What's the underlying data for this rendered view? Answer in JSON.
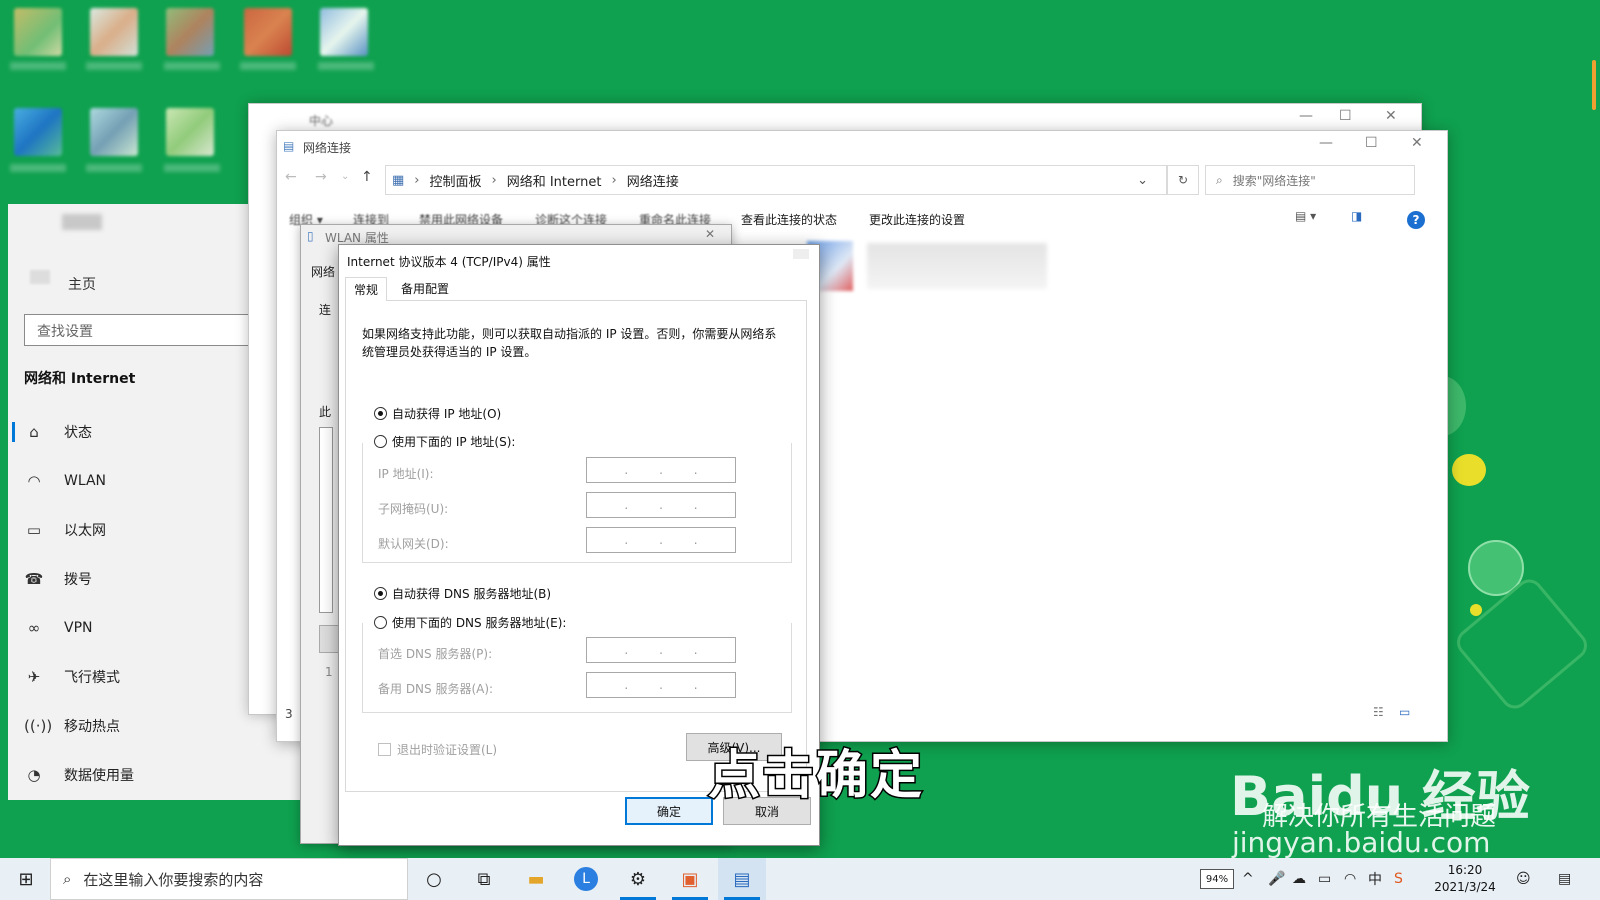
{
  "settings": {
    "home": "主页",
    "search_placeholder": "查找设置",
    "section": "网络和 Internet",
    "nav": [
      {
        "label": "状态",
        "icon": "home-icon"
      },
      {
        "label": "WLAN",
        "icon": "wifi-icon"
      },
      {
        "label": "以太网",
        "icon": "ethernet-icon"
      },
      {
        "label": "拨号",
        "icon": "dialup-icon"
      },
      {
        "label": "VPN",
        "icon": "vpn-icon"
      },
      {
        "label": "飞行模式",
        "icon": "airplane-icon"
      },
      {
        "label": "移动热点",
        "icon": "hotspot-icon"
      },
      {
        "label": "数据使用量",
        "icon": "data-usage-icon"
      }
    ]
  },
  "netcenter": {
    "title": "中心"
  },
  "netconn": {
    "title": "网络连接",
    "breadcrumb": [
      "控制面板",
      "网络和 Internet",
      "网络连接"
    ],
    "search_placeholder": "搜索\"网络连接\"",
    "toolbar": [
      "组织 ▾",
      "连接到",
      "禁用此网络设备",
      "诊断这个连接",
      "重命名此连接",
      "查看此连接的状态",
      "更改此连接的设置"
    ],
    "status_count": "3"
  },
  "wlan": {
    "title": "WLAN 属性",
    "tab": "网络",
    "label_conn": "连",
    "label_this": "此",
    "label_install": "1"
  },
  "tcp": {
    "title": "Internet 协议版本 4 (TCP/IPv4) 属性",
    "tabs": [
      "常规",
      "备用配置"
    ],
    "description": "如果网络支持此功能，则可以获取自动指派的 IP 设置。否则，你需要从网络系统管理员处获得适当的 IP 设置。",
    "auto_ip": "自动获得 IP 地址(O)",
    "manual_ip": "使用下面的 IP 地址(S):",
    "ip_label": "IP 地址(I):",
    "mask_label": "子网掩码(U):",
    "gateway_label": "默认网关(D):",
    "auto_dns": "自动获得 DNS 服务器地址(B)",
    "manual_dns": "使用下面的 DNS 服务器地址(E):",
    "pref_dns_label": "首选 DNS 服务器(P):",
    "alt_dns_label": "备用 DNS 服务器(A):",
    "validate": "退出时验证设置(L)",
    "advanced": "高级(V)...",
    "ok": "确定",
    "cancel": "取消",
    "dot": "."
  },
  "caption": "点击确定",
  "watermark": {
    "brand": "Baidu 经验",
    "slogan": "解决你所有生活问题",
    "url": "jingyan.baidu.com"
  },
  "taskbar": {
    "search_placeholder": "在这里输入你要搜索的内容",
    "battery": "94%",
    "time": "16:20",
    "date": "2021/3/24"
  },
  "colors": {
    "desktop": "#0fa14f",
    "accent": "#0078d7",
    "settings_bg": "#f2f2f2"
  }
}
